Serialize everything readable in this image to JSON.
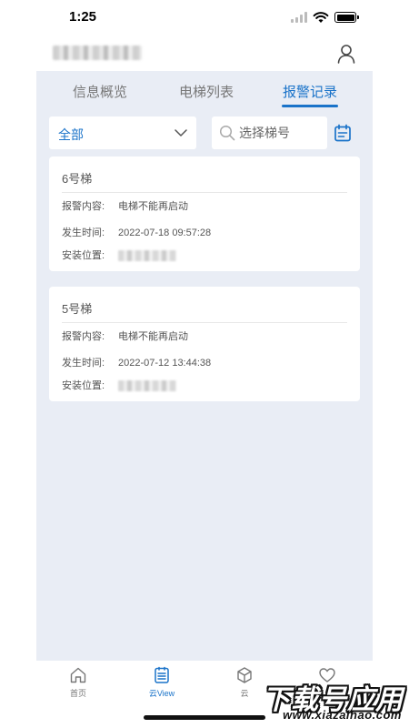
{
  "status_bar": {
    "time": "1:25"
  },
  "header": {
    "title": ""
  },
  "tabs": [
    {
      "label": "信息概览",
      "active": false
    },
    {
      "label": "电梯列表",
      "active": false
    },
    {
      "label": "报警记录",
      "active": true
    }
  ],
  "filters": {
    "select_value": "全部",
    "search_placeholder": "选择梯号"
  },
  "records": [
    {
      "title": "6号梯",
      "content_label": "报警内容:",
      "content": "电梯不能再启动",
      "time_label": "发生时间:",
      "time": "2022-07-18 09:57:28",
      "location_label": "安装位置:",
      "location": ""
    },
    {
      "title": "5号梯",
      "content_label": "报警内容:",
      "content": "电梯不能再启动",
      "time_label": "发生时间:",
      "time": "2022-07-12 13:44:38",
      "location_label": "安装位置:",
      "location": ""
    }
  ],
  "bottom_nav": [
    {
      "label": "首页",
      "icon": "home-icon",
      "active": false
    },
    {
      "label": "云View",
      "icon": "list-icon",
      "active": true
    },
    {
      "label": "云",
      "icon": "cube-icon",
      "active": false
    },
    {
      "label": "",
      "icon": "heart-icon",
      "active": false
    }
  ],
  "watermark": {
    "title": "下载号应用",
    "url": "www.xiazaihao.com"
  },
  "colors": {
    "accent": "#1a73c9",
    "panel_bg": "#e9edf5",
    "card_bg": "#ffffff"
  }
}
